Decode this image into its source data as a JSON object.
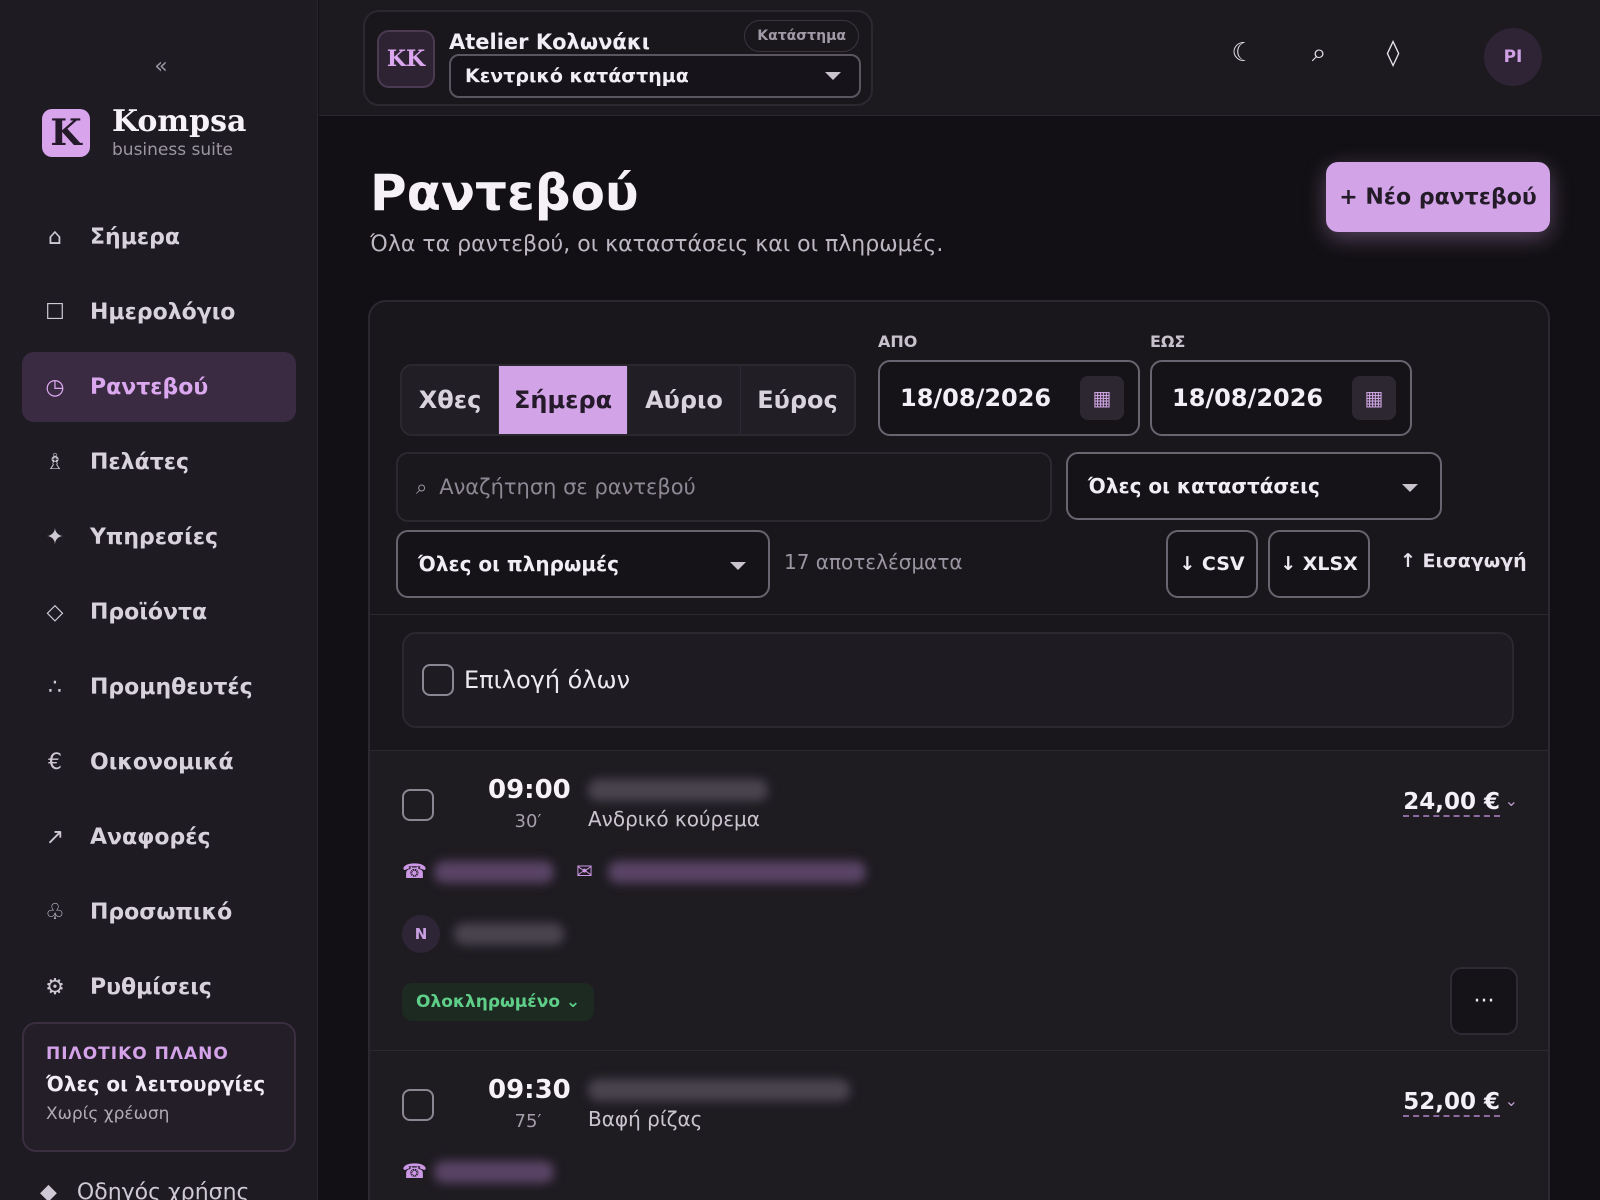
{
  "sidebar": {
    "collapse_icon": "«",
    "brand": {
      "logo_letter": "K",
      "name": "Kompsa",
      "subtitle": "business suite"
    },
    "items": [
      {
        "label": "Σήμερα",
        "icon": "home-icon",
        "glyph": "⌂"
      },
      {
        "label": "Ημερολόγιο",
        "icon": "calendar-icon",
        "glyph": "☐"
      },
      {
        "label": "Ραντεβού",
        "icon": "clock-icon",
        "glyph": "◷"
      },
      {
        "label": "Πελάτες",
        "icon": "person-icon",
        "glyph": "♗"
      },
      {
        "label": "Υπηρεσίες",
        "icon": "sparkle-icon",
        "glyph": "✦"
      },
      {
        "label": "Προϊόντα",
        "icon": "diamond-icon",
        "glyph": "◇"
      },
      {
        "label": "Προμηθευτές",
        "icon": "dots-icon",
        "glyph": "∴"
      },
      {
        "label": "Οικονομικά",
        "icon": "euro-icon",
        "glyph": "€"
      },
      {
        "label": "Αναφορές",
        "icon": "arrow-up-right-icon",
        "glyph": "↗"
      },
      {
        "label": "Προσωπικό",
        "icon": "staff-icon",
        "glyph": "♧"
      },
      {
        "label": "Ρυθμίσεις",
        "icon": "gear-icon",
        "glyph": "⚙"
      }
    ],
    "active_item": "Ραντεβού",
    "plan": {
      "tag": "ΠΙΛΟΤΙΚΟ ΠΛΑΝΟ",
      "title": "Όλες οι λειτουργίες",
      "subtitle": "Χωρίς χρέωση"
    },
    "guide": {
      "label": "Οδηγός χρήσης",
      "glyph": "◆"
    }
  },
  "topbar": {
    "store": {
      "initials": "KK",
      "name": "Atelier Κολωνάκι",
      "tag": "Κατάστημα",
      "selected_branch": "Κεντρικό κατάστημα"
    },
    "icons": {
      "theme": "☾",
      "search": "⌕",
      "notifications": "◊"
    },
    "user_initials": "PI"
  },
  "page": {
    "title": "Ραντεβού",
    "subtitle": "Όλα τα ραντεβού, οι καταστάσεις και οι πληρωμές.",
    "new_button": "+ Νέο ραντεβού"
  },
  "filters": {
    "tabs": [
      "Χθες",
      "Σήμερα",
      "Αύριο",
      "Εύρος"
    ],
    "active_tab": "Σήμερα",
    "from_label": "ΑΠΟ",
    "from_date": "18/08/2026",
    "to_label": "ΕΩΣ",
    "to_date": "18/08/2026",
    "calendar_glyph": "▦",
    "search_placeholder": "Αναζήτηση σε ραντεβού",
    "search_glyph": "⌕",
    "status_select": "Όλες οι καταστάσεις",
    "payment_select": "Όλες οι πληρωμές",
    "result_count": "17 αποτελέσματα",
    "export_csv": "↓ CSV",
    "export_xlsx": "↓ XLSX",
    "import": "↑ Εισαγωγή"
  },
  "list": {
    "select_all": "Επιλογή όλων",
    "appointments": [
      {
        "time": "09:00",
        "duration": "30′",
        "service": "Ανδρικό κούρεμα",
        "price": "24,00 €",
        "staff_initial": "N",
        "status": "Ολοκληρωμένο ⌄",
        "more": "···"
      },
      {
        "time": "09:30",
        "duration": "75′",
        "service": "Βαφή ρίζας",
        "price": "52,00 €"
      }
    ],
    "phone_glyph": "☎",
    "mail_glyph": "✉",
    "price_chevron": "⌄"
  },
  "colors": {
    "accent": "#d3a3e8",
    "background": "#121014",
    "sidebar": "#1e1b22",
    "success": "#5fce88"
  }
}
